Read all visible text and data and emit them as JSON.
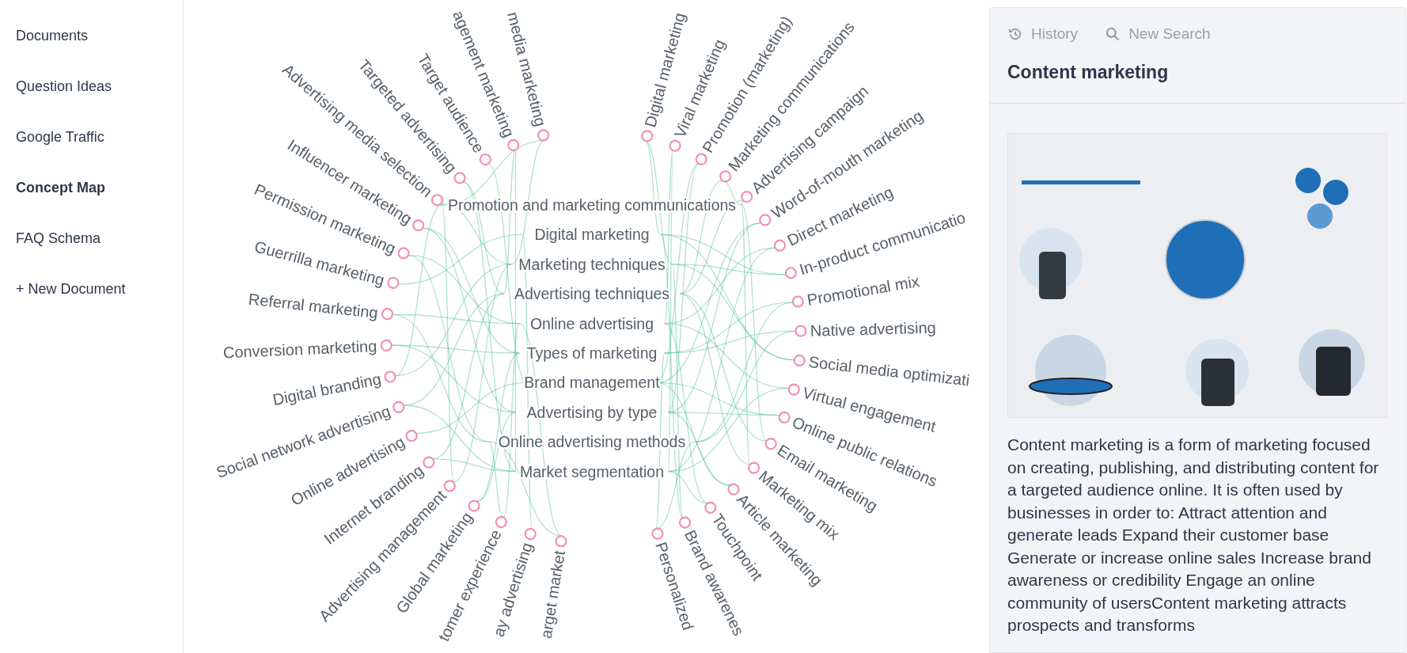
{
  "sidebar": {
    "items": [
      {
        "label": "Documents",
        "selected": false
      },
      {
        "label": "Question Ideas",
        "selected": false
      },
      {
        "label": "Google Traffic",
        "selected": false
      },
      {
        "label": "Concept Map",
        "selected": true
      },
      {
        "label": "FAQ Schema",
        "selected": false
      },
      {
        "label": "+ New Document",
        "selected": false
      }
    ]
  },
  "concept_map": {
    "center_topics": [
      "Promotion and marketing communications",
      "Digital marketing",
      "Marketing techniques",
      "Advertising techniques",
      "Online advertising",
      "Types of marketing",
      "Brand management",
      "Advertising by type",
      "Online advertising methods",
      "Market segmentation"
    ],
    "left_topics": [
      "media marketing",
      "agement marketing",
      "Target audience",
      "Targeted advertising",
      "Advertising media selection",
      "Influencer marketing",
      "Permission marketing",
      "Guerrilla marketing",
      "Referral marketing",
      "Conversion marketing",
      "Digital branding",
      "Social network advertising",
      "Online advertising",
      "Internet branding",
      "Advertising management",
      "Global marketing",
      "tomer experience",
      "ay advertising",
      "arget market"
    ],
    "right_topics": [
      "Digital marketing",
      "Viral marketing",
      "Promotion (marketing)",
      "Marketing communications",
      "Advertising campaign",
      "Word-of-mouth marketing",
      "Direct marketing",
      "In-product communicatio",
      "Promotional mix",
      "Native advertising",
      "Social media optimizati",
      "Virtual engagement",
      "Online public relations",
      "Email marketing",
      "Marketing mix",
      "Article marketing",
      "Touchpoint",
      "Brand awarenes",
      "Personalized"
    ]
  },
  "panel": {
    "tabs": [
      {
        "label": "History",
        "kind": "history"
      },
      {
        "label": "New Search",
        "kind": "search"
      }
    ],
    "title": "Content marketing",
    "description": "Content marketing is a form of marketing focused on creating, publishing, and distributing content for a targeted audience online. It is often used by businesses in order to: Attract attention and generate leads Expand their customer base Generate or increase online sales Increase brand awareness or credibility Engage an online community of usersContent marketing attracts prospects and transforms"
  }
}
